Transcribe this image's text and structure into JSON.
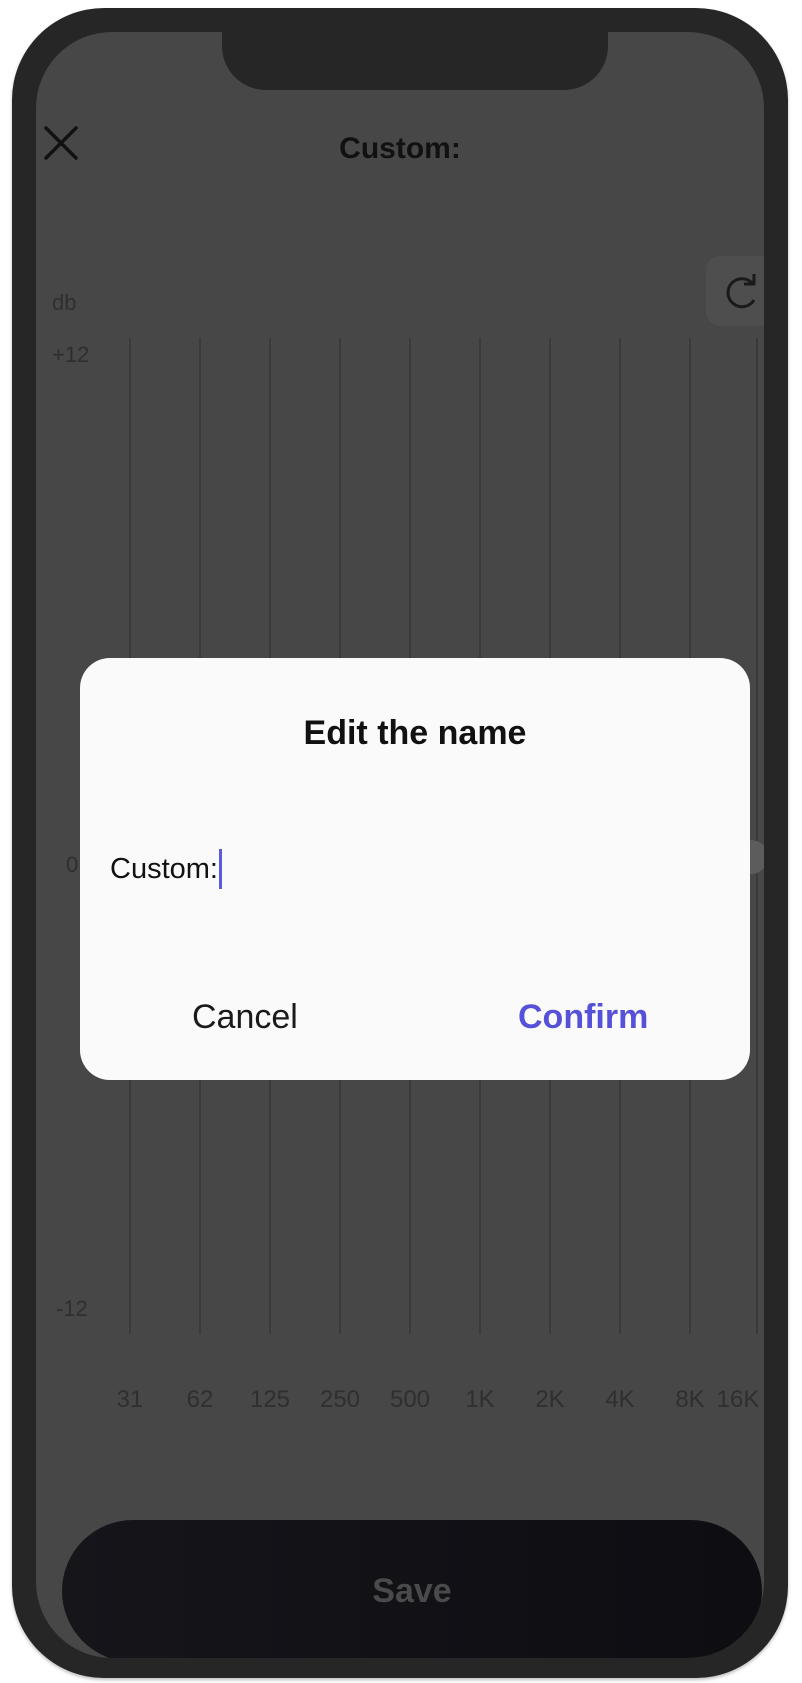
{
  "header": {
    "title": "Custom:",
    "close_icon": "close-icon",
    "reset_icon": "refresh-icon"
  },
  "equalizer": {
    "unit_label": "db",
    "max_label": "+12",
    "zero_label": "0",
    "min_label": "-12",
    "bands": [
      "31",
      "62",
      "125",
      "250",
      "500",
      "1K",
      "2K",
      "4K",
      "8K",
      "16K"
    ]
  },
  "dialog": {
    "title": "Edit the name",
    "input_value": "Custom:",
    "cancel_label": "Cancel",
    "confirm_label": "Confirm"
  },
  "footer": {
    "save_label": "Save"
  },
  "colors": {
    "accent": "#5551d8",
    "overlay": "#474747",
    "frame": "#262626"
  }
}
